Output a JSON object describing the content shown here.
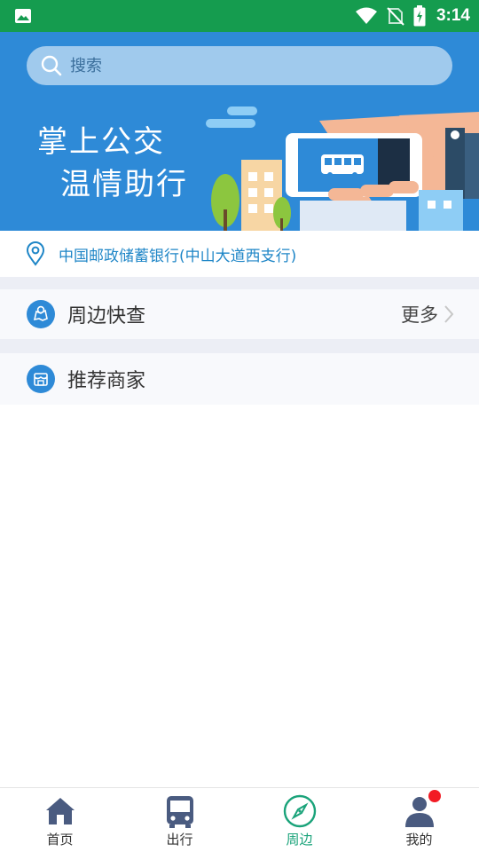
{
  "status_bar": {
    "time": "3:14",
    "icons": [
      "image-icon",
      "wifi-icon",
      "no-sim-icon",
      "battery-charging-icon"
    ]
  },
  "search": {
    "placeholder": "搜索",
    "icon": "search-icon"
  },
  "banner": {
    "line1": "掌上公交",
    "line2": "温情助行",
    "colors": {
      "background": "#2e8ad7"
    }
  },
  "location": {
    "icon": "location-pin-icon",
    "text": "中国邮政储蓄银行(中山大道西支行)"
  },
  "sections": {
    "nearby": {
      "icon": "map-search-icon",
      "title": "周边快查",
      "more_label": "更多",
      "more_icon": "chevron-right-icon"
    },
    "recommended": {
      "icon": "store-icon",
      "title": "推荐商家"
    }
  },
  "bottom_nav": {
    "items": [
      {
        "label": "首页",
        "icon": "home-icon",
        "active": false
      },
      {
        "label": "出行",
        "icon": "bus-icon",
        "active": false
      },
      {
        "label": "周边",
        "icon": "compass-icon",
        "active": true
      },
      {
        "label": "我的",
        "icon": "user-icon",
        "active": false,
        "badge": true
      }
    ]
  },
  "colors": {
    "status_bar": "#159c4f",
    "accent": "#1f86c7",
    "active_nav": "#1aa37a",
    "badge": "#f21b24"
  }
}
